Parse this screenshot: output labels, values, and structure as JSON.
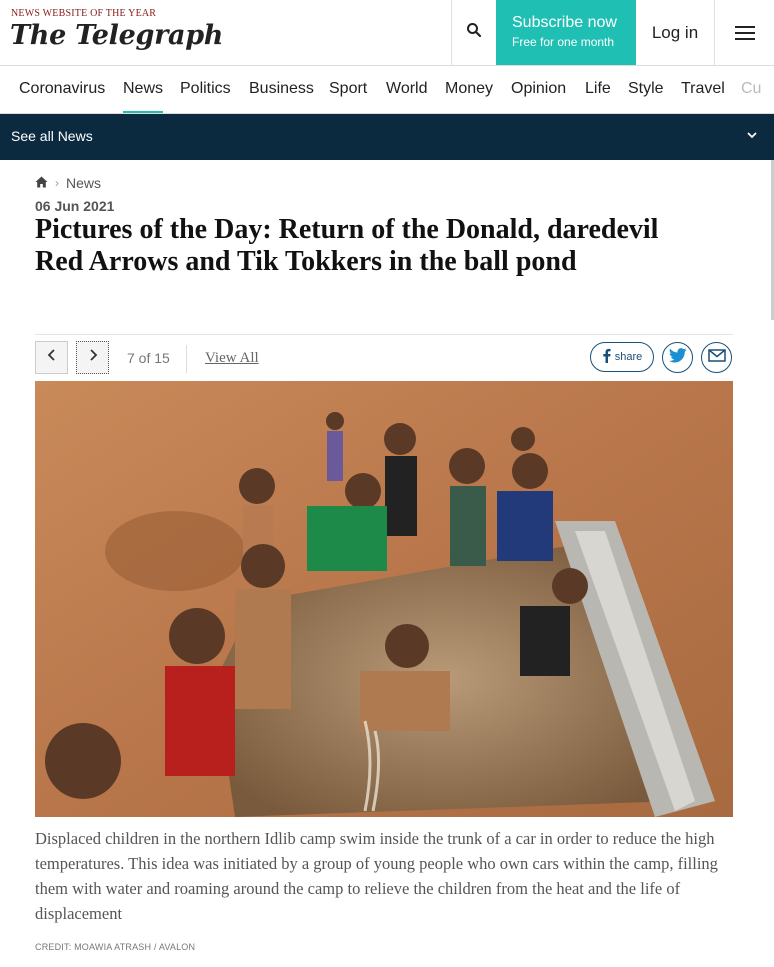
{
  "header": {
    "award": "NEWS WEBSITE OF THE YEAR",
    "logo": "The Telegraph",
    "subscribe_label": "Subscribe now",
    "subscribe_sub": "Free for one month",
    "login_label": "Log in",
    "accent_color": "#1fc0b3"
  },
  "nav": {
    "items": [
      "Coronavirus",
      "News",
      "Politics",
      "Business",
      "Sport",
      "World",
      "Money",
      "Opinion",
      "Life",
      "Style",
      "Travel",
      "Cu"
    ],
    "active": "News"
  },
  "subbar": {
    "label": "See all News",
    "bg_color": "#0b2a3f"
  },
  "article": {
    "breadcrumb": "News",
    "date": "06 Jun 2021",
    "title": "Pictures of the Day: Return of the Donald, daredevil Red Arrows and Tik Tokkers in the ball pond"
  },
  "gallery": {
    "counter": "7 of 15",
    "view_all": "View All",
    "share_label": "share",
    "caption": " Displaced children in the northern Idlib camp swim inside the trunk of a car in order to reduce the high temperatures. This idea was initiated by a group of young people who own cars within the camp, filling them with water and roaming around the camp to relieve the children from the heat and the life of displacement",
    "credit": "CREDIT: MOAWIA ATRASH / AVALON"
  }
}
